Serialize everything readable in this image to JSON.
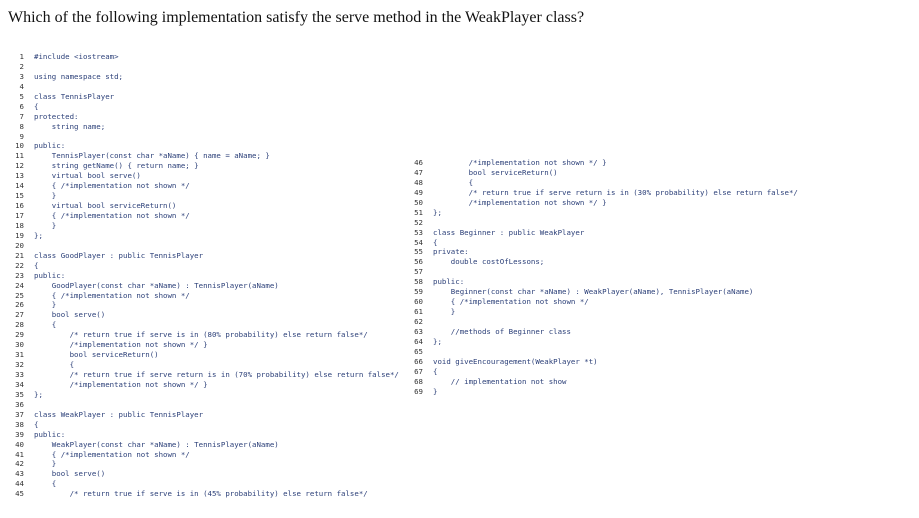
{
  "question": "Which of the following implementation satisfy the serve method in the WeakPlayer class?",
  "code_left": [
    {
      "n": "1",
      "text": "#include <iostream>"
    },
    {
      "n": "2",
      "text": ""
    },
    {
      "n": "3",
      "text": "using namespace std;"
    },
    {
      "n": "4",
      "text": ""
    },
    {
      "n": "5",
      "text": "class TennisPlayer"
    },
    {
      "n": "6",
      "text": "{"
    },
    {
      "n": "7",
      "text": "protected:"
    },
    {
      "n": "8",
      "text": "    string name;"
    },
    {
      "n": "9",
      "text": ""
    },
    {
      "n": "10",
      "text": "public:"
    },
    {
      "n": "11",
      "text": "    TennisPlayer(const char *aName) { name = aName; }"
    },
    {
      "n": "12",
      "text": "    string getName() { return name; }"
    },
    {
      "n": "13",
      "text": "    virtual bool serve()"
    },
    {
      "n": "14",
      "text": "    { /*implementation not shown */"
    },
    {
      "n": "15",
      "text": "    }"
    },
    {
      "n": "16",
      "text": "    virtual bool serviceReturn()"
    },
    {
      "n": "17",
      "text": "    { /*implementation not shown */"
    },
    {
      "n": "18",
      "text": "    }"
    },
    {
      "n": "19",
      "text": "};"
    },
    {
      "n": "20",
      "text": ""
    },
    {
      "n": "21",
      "text": "class GoodPlayer : public TennisPlayer"
    },
    {
      "n": "22",
      "text": "{"
    },
    {
      "n": "23",
      "text": "public:"
    },
    {
      "n": "24",
      "text": "    GoodPlayer(const char *aName) : TennisPlayer(aName)"
    },
    {
      "n": "25",
      "text": "    { /*implementation not shown */"
    },
    {
      "n": "26",
      "text": "    }"
    },
    {
      "n": "27",
      "text": "    bool serve()"
    },
    {
      "n": "28",
      "text": "    {"
    },
    {
      "n": "29",
      "text": "        /* return true if serve is in (80% probability) else return false*/"
    },
    {
      "n": "30",
      "text": "        /*implementation not shown */ }"
    },
    {
      "n": "31",
      "text": "        bool serviceReturn()"
    },
    {
      "n": "32",
      "text": "        {"
    },
    {
      "n": "33",
      "text": "        /* return true if serve return is in (70% probability) else return false*/"
    },
    {
      "n": "34",
      "text": "        /*implementation not shown */ }"
    },
    {
      "n": "35",
      "text": "};"
    },
    {
      "n": "36",
      "text": ""
    },
    {
      "n": "37",
      "text": "class WeakPlayer : public TennisPlayer"
    },
    {
      "n": "38",
      "text": "{"
    },
    {
      "n": "39",
      "text": "public:"
    },
    {
      "n": "40",
      "text": "    WeakPlayer(const char *aName) : TennisPlayer(aName)"
    },
    {
      "n": "41",
      "text": "    { /*implementation not shown */"
    },
    {
      "n": "42",
      "text": "    }"
    },
    {
      "n": "43",
      "text": "    bool serve()"
    },
    {
      "n": "44",
      "text": "    {"
    },
    {
      "n": "45",
      "text": "        /* return true if serve is in (45% probability) else return false*/"
    }
  ],
  "code_right": [
    {
      "n": "46",
      "text": "        /*implementation not shown */ }"
    },
    {
      "n": "47",
      "text": "        bool serviceReturn()"
    },
    {
      "n": "48",
      "text": "        {"
    },
    {
      "n": "49",
      "text": "        /* return true if serve return is in (30% probability) else return false*/"
    },
    {
      "n": "50",
      "text": "        /*implementation not shown */ }"
    },
    {
      "n": "51",
      "text": "};"
    },
    {
      "n": "52",
      "text": ""
    },
    {
      "n": "53",
      "text": "class Beginner : public WeakPlayer"
    },
    {
      "n": "54",
      "text": "{"
    },
    {
      "n": "55",
      "text": "private:"
    },
    {
      "n": "56",
      "text": "    double costOfLessons;"
    },
    {
      "n": "57",
      "text": ""
    },
    {
      "n": "58",
      "text": "public:"
    },
    {
      "n": "59",
      "text": "    Beginner(const char *aName) : WeakPlayer(aName), TennisPlayer(aName)"
    },
    {
      "n": "60",
      "text": "    { /*implementation not shown */"
    },
    {
      "n": "61",
      "text": "    }"
    },
    {
      "n": "62",
      "text": ""
    },
    {
      "n": "63",
      "text": "    //methods of Beginner class"
    },
    {
      "n": "64",
      "text": "};"
    },
    {
      "n": "65",
      "text": ""
    },
    {
      "n": "66",
      "text": "void giveEncouragement(WeakPlayer *t)"
    },
    {
      "n": "67",
      "text": "{"
    },
    {
      "n": "68",
      "text": "    // implementation not show"
    },
    {
      "n": "69",
      "text": "}"
    }
  ]
}
